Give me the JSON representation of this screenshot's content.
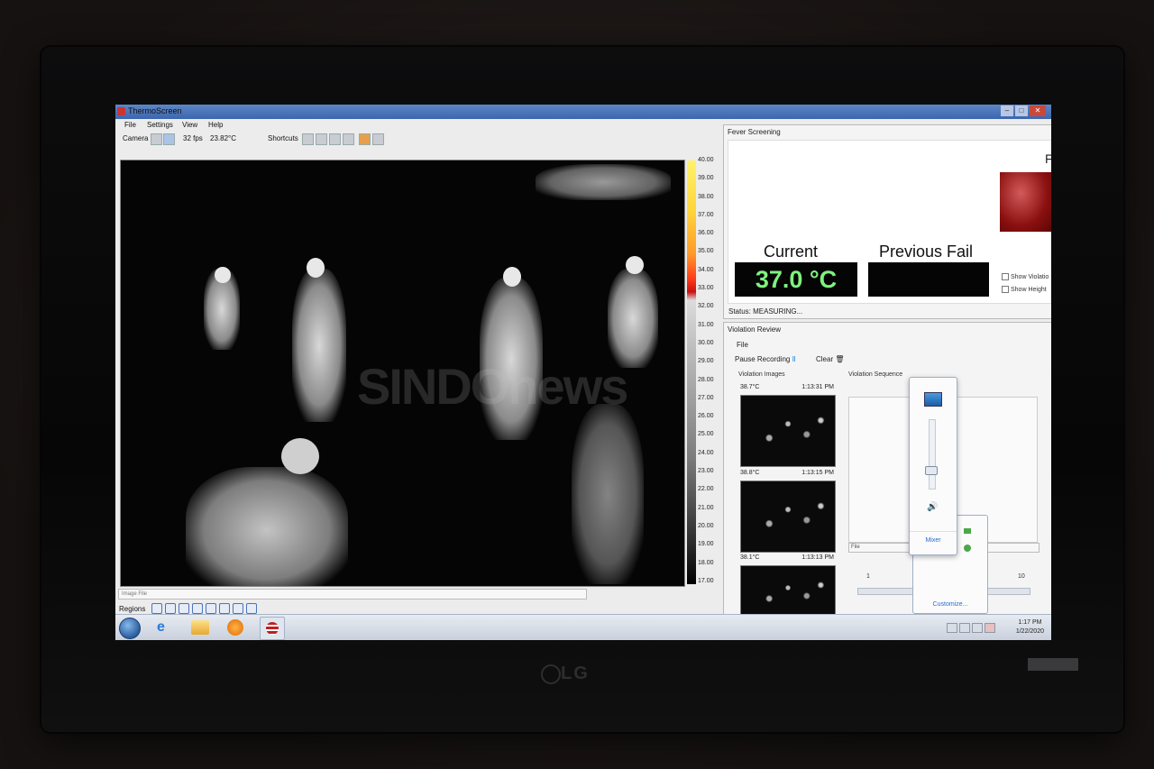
{
  "window": {
    "title": "ThermoScreen"
  },
  "menu": {
    "file": "File",
    "settings": "Settings",
    "view": "View",
    "help": "Help"
  },
  "toolbar": {
    "camera_label": "Camera",
    "fps": "32 fps",
    "temp": "23.82°C",
    "shortcuts_label": "Shortcuts"
  },
  "scale": {
    "labels": [
      "40.00",
      "39.00",
      "38.00",
      "37.00",
      "36.00",
      "35.00",
      "34.00",
      "33.00",
      "32.00",
      "31.00",
      "30.00",
      "29.00",
      "28.00",
      "27.00",
      "26.00",
      "25.00",
      "24.00",
      "23.00",
      "22.00",
      "21.00",
      "20.00",
      "19.00",
      "18.00",
      "17.00"
    ]
  },
  "watermark": "SINDOnews",
  "image_file_label": "Image File",
  "regions_label": "Regions",
  "fever": {
    "title": "Fever Screening",
    "current_label": "Current",
    "current_value": "37.0 °C",
    "previous_label": "Previous Fail",
    "f_letter": "F",
    "show_violation": "Show Violatio",
    "show_height": "Show Height",
    "status": "Status: MEASURING..."
  },
  "violation": {
    "title": "Violation Review",
    "file_menu": "File",
    "pause": "Pause Recording",
    "clear": "Clear",
    "images_label": "Violation Images",
    "sequence_label": "Violation Sequence",
    "thumbs": [
      {
        "temp": "38.7°C",
        "time": "1:13:31 PM"
      },
      {
        "temp": "38.8°C",
        "time": "1:13:15 PM"
      },
      {
        "temp": "38.1°C",
        "time": "1:13:13 PM"
      }
    ],
    "seq_file": "File",
    "slider_min": "1",
    "slider_max": "10"
  },
  "volume": {
    "mixer": "Mixer",
    "customize": "Customize..."
  },
  "taskbar": {
    "time": "1:17 PM",
    "date": "1/22/2020"
  },
  "tv": {
    "brand": "LG"
  }
}
